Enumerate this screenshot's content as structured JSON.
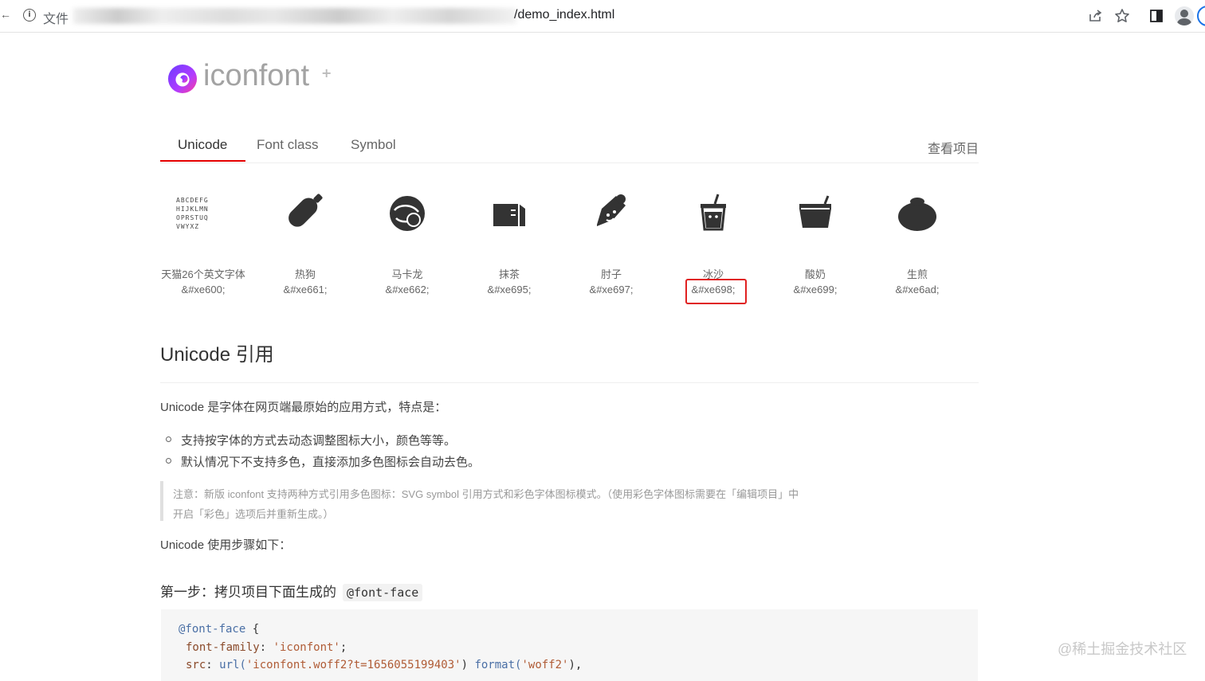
{
  "browser": {
    "left_edge": "←",
    "info_icon": "i",
    "scheme": "文件",
    "url_suffix": "/demo_index.html",
    "share_icon": "share-icon",
    "star_icon": "star-icon",
    "sidepanel_icon": "side-panel-icon",
    "profile_icon": "profile-icon"
  },
  "logo": {
    "text": "iconfont",
    "plus": "+"
  },
  "tabs": [
    {
      "label": "Unicode",
      "active": true
    },
    {
      "label": "Font class",
      "active": false
    },
    {
      "label": "Symbol",
      "active": false
    }
  ],
  "tabs_right": "查看项目",
  "icons": [
    {
      "name": "天猫26个英文字体",
      "code": "&#xe600;",
      "glyph": "alphabet-icon"
    },
    {
      "name": "热狗",
      "code": "&#xe661;",
      "glyph": "hotdog-icon"
    },
    {
      "name": "马卡龙",
      "code": "&#xe662;",
      "glyph": "macaron-icon"
    },
    {
      "name": "抹茶",
      "code": "&#xe695;",
      "glyph": "matcha-icon"
    },
    {
      "name": "肘子",
      "code": "&#xe697;",
      "glyph": "pork-knuckle-icon"
    },
    {
      "name": "冰沙",
      "code": "&#xe698;",
      "glyph": "smoothie-icon"
    },
    {
      "name": "酸奶",
      "code": "&#xe699;",
      "glyph": "yogurt-icon"
    },
    {
      "name": "生煎",
      "code": "&#xe6ad;",
      "glyph": "fried-bun-icon"
    }
  ],
  "alphabet_lines": [
    "ABCDEFG",
    "HIJKLMN",
    "OPRSTUQ",
    "VWYXZ"
  ],
  "section": {
    "title": "Unicode 引用",
    "intro": "Unicode 是字体在网页端最原始的应用方式，特点是：",
    "bullets": [
      "支持按字体的方式去动态调整图标大小，颜色等等。",
      "默认情况下不支持多色，直接添加多色图标会自动去色。"
    ],
    "note_line1": "注意：新版 iconfont 支持两种方式引用多色图标：SVG symbol 引用方式和彩色字体图标模式。（使用彩色字体图标需要在「编辑项目」中",
    "note_line2": "开启「彩色」选项后并重新生成。）",
    "steps_intro": "Unicode 使用步骤如下：",
    "step1_text": "第一步：拷贝项目下面生成的",
    "step1_code": "@font-face"
  },
  "code": {
    "l1_kw": "@font-face",
    "l1_brace": " {",
    "l2_prop": "font-family",
    "l2_colon": ": ",
    "l2_val": "'iconfont'",
    "l2_end": ";",
    "l3_prop": "src",
    "l3_colon": ": ",
    "l3_url_fn": "url(",
    "l3_url": "'iconfont.woff2?t=1656055199403'",
    "l3_close": ") ",
    "l3_fmt_fn": "format(",
    "l3_fmt": "'woff2'",
    "l3_end": "),"
  },
  "watermark": "@稀土掘金技术社区"
}
